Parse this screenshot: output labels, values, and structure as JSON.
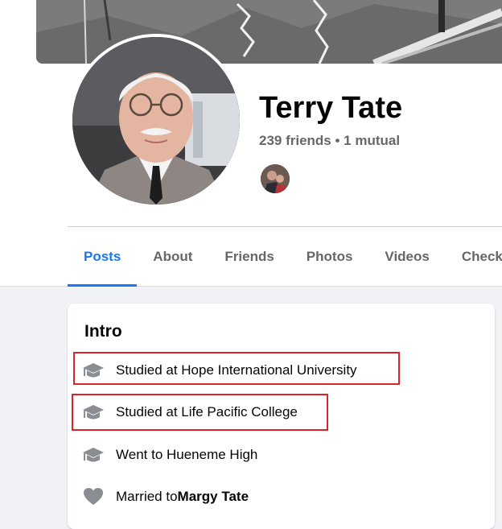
{
  "profile": {
    "name": "Terry Tate",
    "friends_count": "239 friends",
    "separator": " • ",
    "mutual": "1 mutual"
  },
  "tabs": [
    {
      "label": "Posts",
      "active": true
    },
    {
      "label": "About",
      "active": false
    },
    {
      "label": "Friends",
      "active": false
    },
    {
      "label": "Photos",
      "active": false
    },
    {
      "label": "Videos",
      "active": false
    },
    {
      "label": "Check",
      "active": false
    }
  ],
  "intro": {
    "title": "Intro",
    "items": [
      {
        "icon": "graduation-cap-icon",
        "text": "Studied at Hope International University"
      },
      {
        "icon": "graduation-cap-icon",
        "text": "Studied at Life Pacific College"
      },
      {
        "icon": "graduation-cap-icon",
        "text": "Went to Hueneme High"
      },
      {
        "icon": "heart-icon",
        "prefix": "Married to ",
        "emphasis": "Margy Tate"
      }
    ]
  },
  "colors": {
    "accent": "#1877f2",
    "muted_text": "#65676b",
    "highlight_box": "#d9242c",
    "icon_gray": "#8a8d91"
  }
}
